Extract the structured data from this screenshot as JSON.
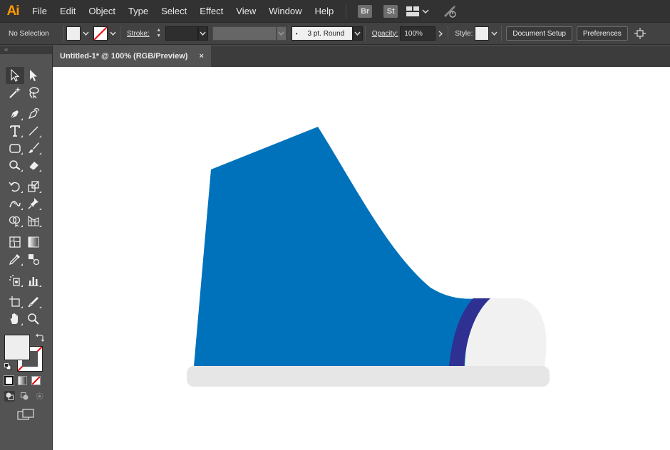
{
  "app": {
    "logo": "Ai"
  },
  "menu": [
    "File",
    "Edit",
    "Object",
    "Type",
    "Select",
    "Effect",
    "View",
    "Window",
    "Help"
  ],
  "menu_apps": {
    "bridge": "Br",
    "stock": "St"
  },
  "control": {
    "selection_label": "No Selection",
    "stroke_label": "Stroke:",
    "brush_value": "3 pt. Round",
    "opacity_label": "Opacity:",
    "opacity_value": "100%",
    "style_label": "Style:",
    "document_setup": "Document Setup",
    "preferences": "Preferences"
  },
  "document_tab": {
    "title": "Untitled-1* @ 100% (RGB/Preview)",
    "close": "×"
  },
  "toolbox": {
    "collapse": "‹‹"
  },
  "colors": {
    "shoe_body": "#0072BC",
    "shoe_band": "#2E3192",
    "toe_cap": "#F1F1F2",
    "sole": "#E6E6E6",
    "brand_orange": "#FF9A00"
  }
}
